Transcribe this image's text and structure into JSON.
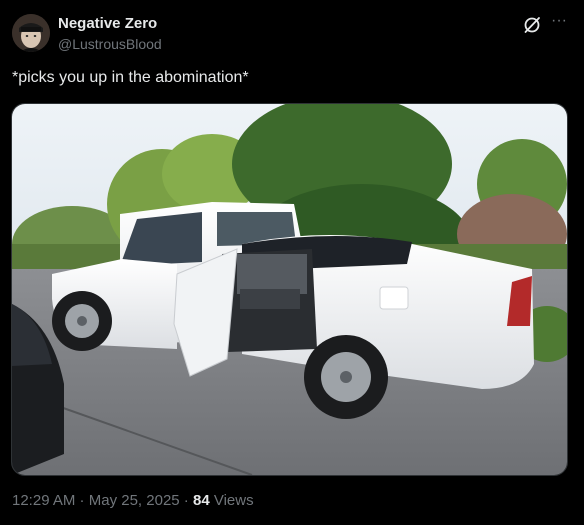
{
  "author": {
    "name": "Negative Zero",
    "handle": "@LustrousBlood",
    "avatar_icon": "profile-avatar"
  },
  "header_icons": {
    "grok": "grok-icon",
    "more": "more-icon",
    "more_glyph": "···"
  },
  "tweet": {
    "text": "*picks you up in the abomination*"
  },
  "media": {
    "kind": "photo",
    "alt_icon": "car-photo"
  },
  "meta": {
    "time": "12:29 AM",
    "separator": " · ",
    "date": "May 25, 2025",
    "views_count": "84",
    "views_label": " Views"
  },
  "colors": {
    "background": "#000000",
    "primary_text": "#e7e9ea",
    "secondary_text": "#71767b",
    "border": "#2f3336"
  }
}
